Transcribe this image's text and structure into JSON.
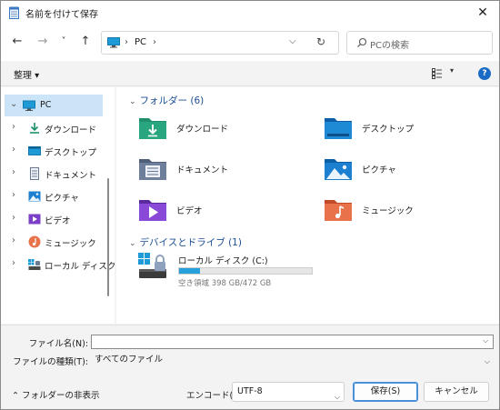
{
  "window": {
    "title": "名前を付けて保存",
    "close_symbol": "✕"
  },
  "nav": {
    "back_symbol": "←",
    "forward_symbol": "→",
    "recent_symbol": "˅",
    "up_symbol": "↑",
    "address_sep1": "›",
    "address_location": "PC",
    "address_sep2": "›",
    "address_dropdown_symbol": "⌵",
    "refresh_symbol": "↻",
    "search_placeholder": "PCの検索"
  },
  "toolbar": {
    "organize_label": "整理 ▾",
    "view_dropdown_symbol": "▾",
    "help_label": "?"
  },
  "sidebar": {
    "items": [
      {
        "label": "PC",
        "icon": "pc-icon",
        "chev": "⌄",
        "selected": true
      },
      {
        "label": "ダウンロード",
        "icon": "download-icon",
        "chev": "›"
      },
      {
        "label": "デスクトップ",
        "icon": "desktop-icon",
        "chev": "›"
      },
      {
        "label": "ドキュメント",
        "icon": "documents-icon",
        "chev": "›"
      },
      {
        "label": "ピクチャ",
        "icon": "pictures-icon",
        "chev": "›"
      },
      {
        "label": "ビデオ",
        "icon": "videos-icon",
        "chev": "›"
      },
      {
        "label": "ミュージック",
        "icon": "music-icon",
        "chev": "›"
      },
      {
        "label": "ローカル ディスク (",
        "icon": "drive-icon",
        "chev": "›"
      }
    ]
  },
  "content": {
    "folders_header": "フォルダー (6)",
    "folders": [
      {
        "label": "ダウンロード",
        "icon": "download-folder-icon"
      },
      {
        "label": "デスクトップ",
        "icon": "desktop-folder-icon"
      },
      {
        "label": "ドキュメント",
        "icon": "documents-folder-icon"
      },
      {
        "label": "ピクチャ",
        "icon": "pictures-folder-icon"
      },
      {
        "label": "ビデオ",
        "icon": "videos-folder-icon"
      },
      {
        "label": "ミュージック",
        "icon": "music-folder-icon"
      }
    ],
    "devices_header": "デバイスとドライブ (1)",
    "drive": {
      "label": "ローカル ディスク (C:)",
      "free_text": "空き領域 398 GB/472 GB",
      "used_fraction": 0.157
    }
  },
  "form": {
    "filename_label": "ファイル名(N):",
    "filename_value": "",
    "filetype_label": "ファイルの種類(T):",
    "filetype_value": "すべてのファイル"
  },
  "footer": {
    "hide_folders_label": "フォルダーの非表示",
    "hide_folders_chev": "⌃",
    "encoding_label": "エンコード(E):",
    "encoding_value": "UTF-8",
    "save_label": "保存(S)",
    "cancel_label": "キャンセル"
  },
  "colors": {
    "accent": "#1a6bc6",
    "selection": "#cce4f7",
    "group_header": "#1b4f95",
    "drive_bar": "#26a0da"
  }
}
